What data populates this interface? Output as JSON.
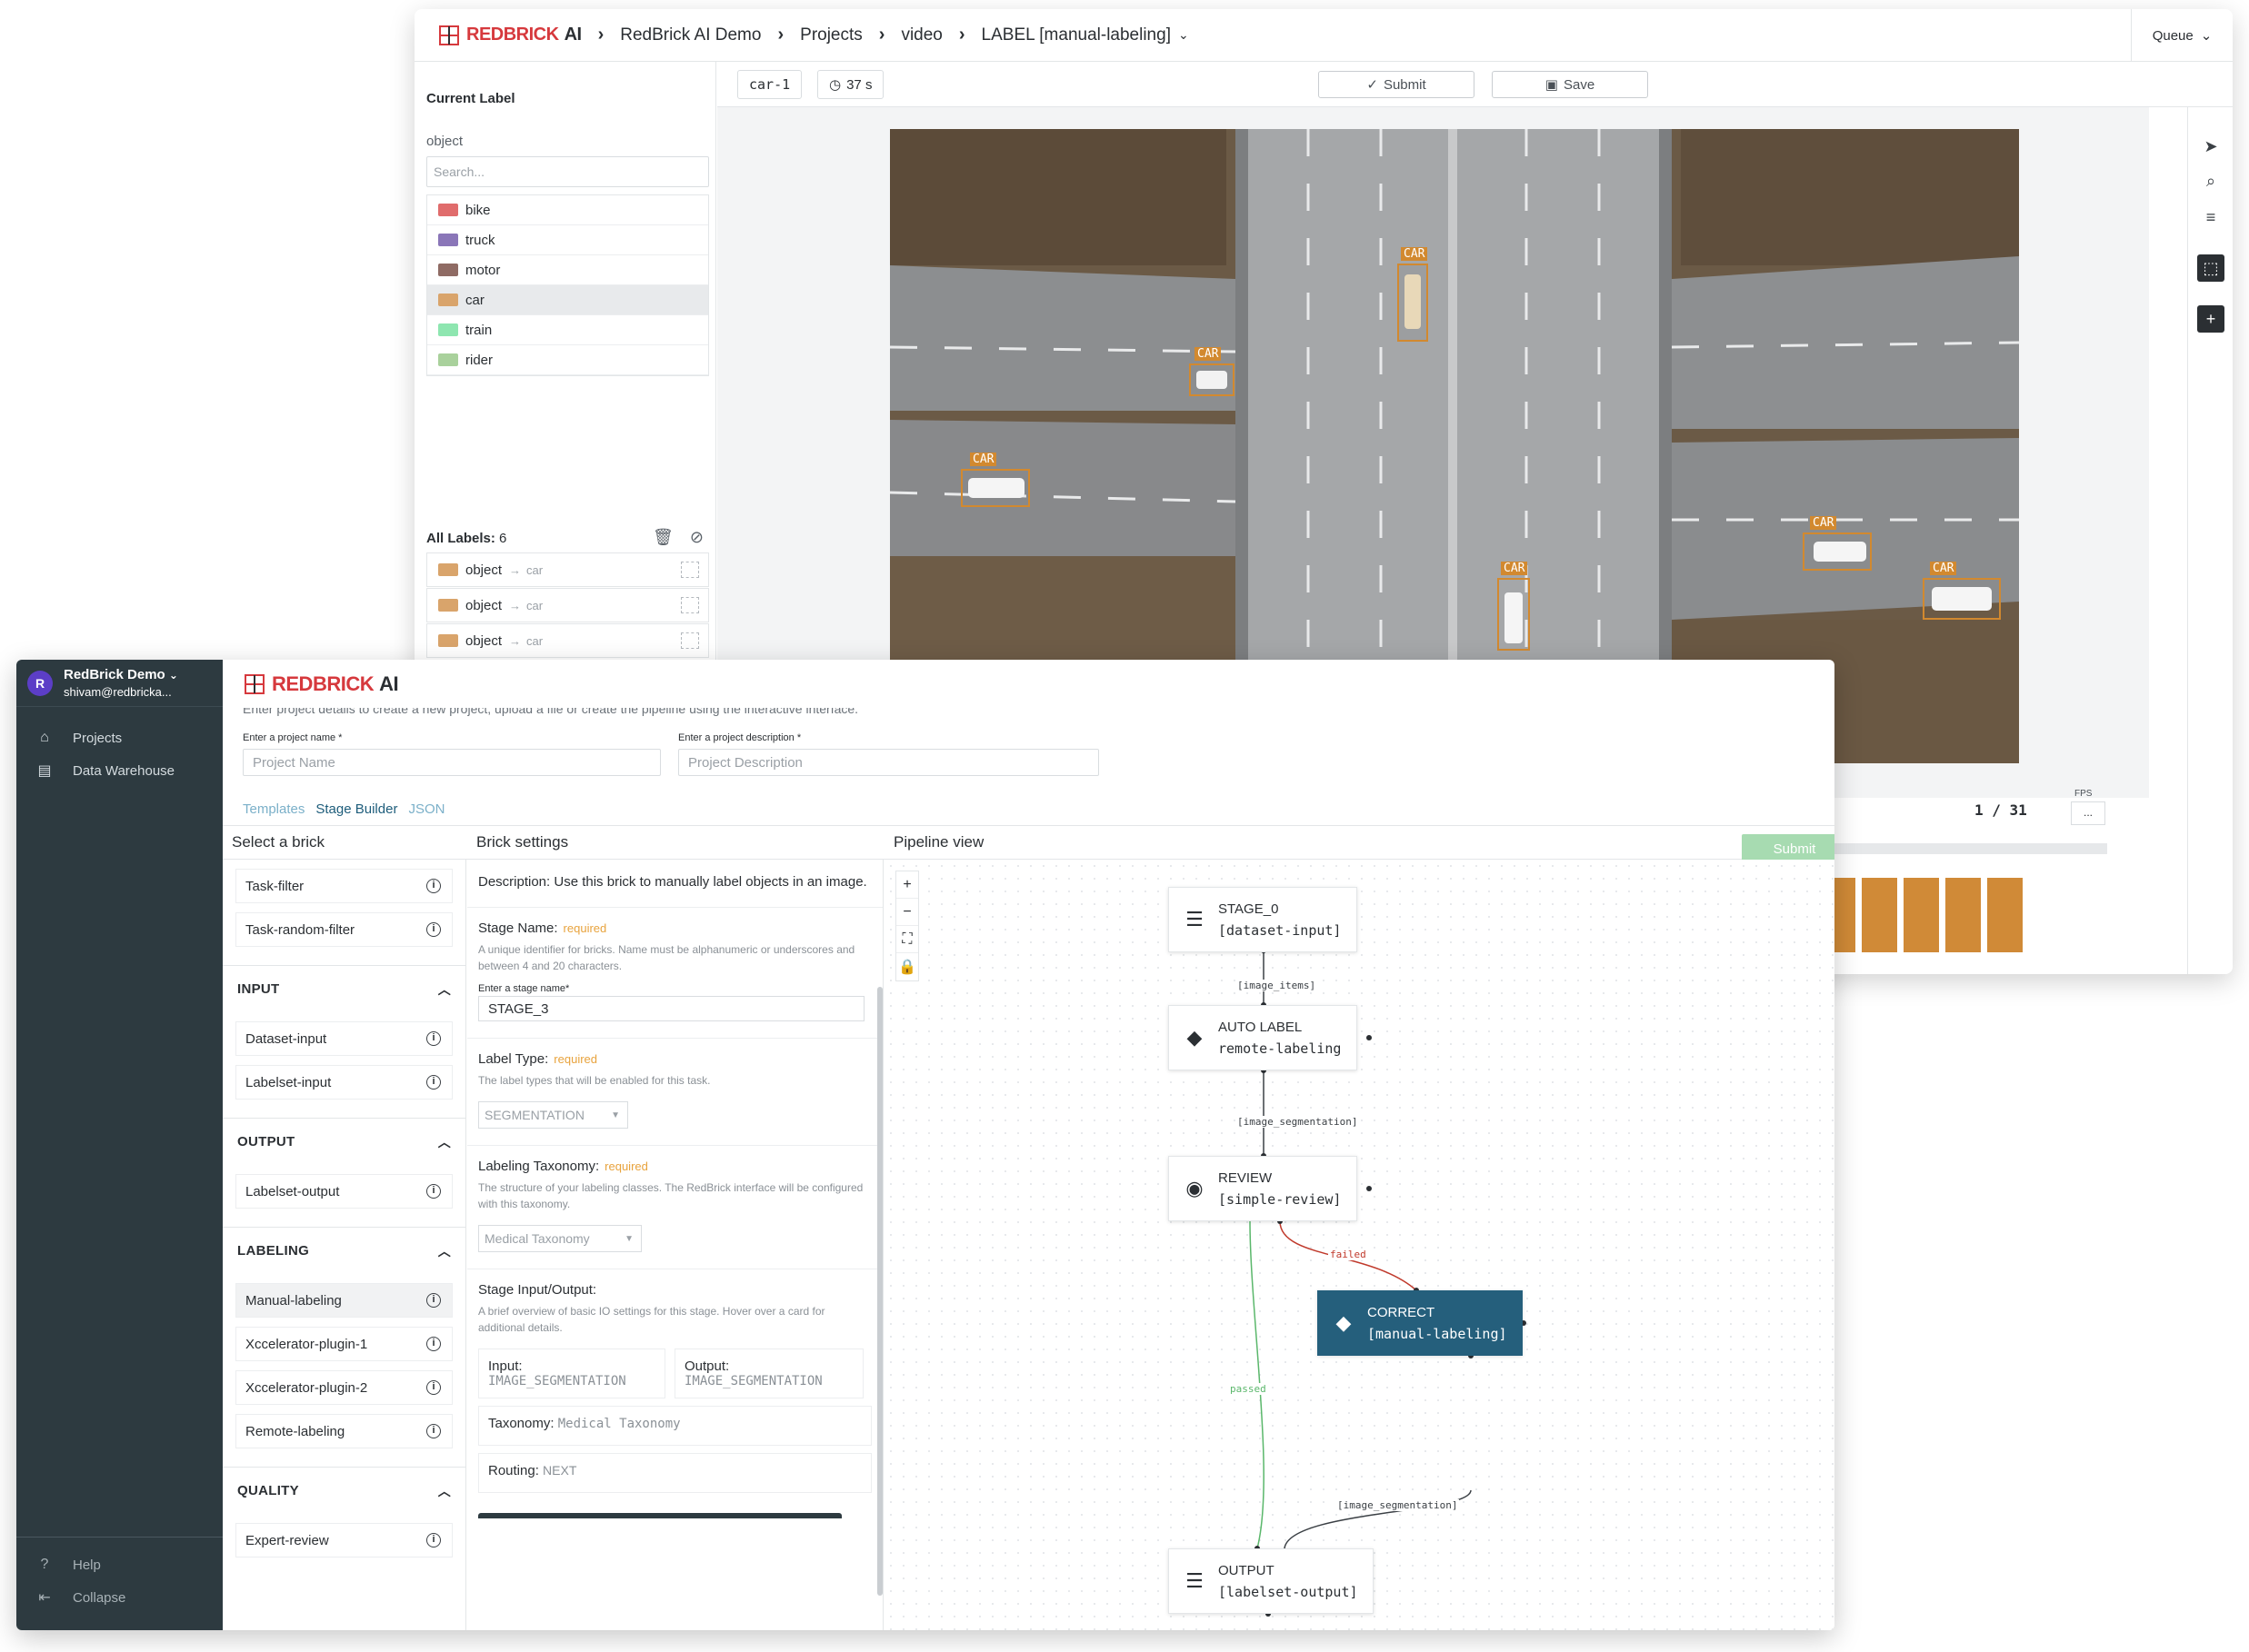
{
  "back": {
    "logo": {
      "red": "REDBRICK",
      "dark": "AI"
    },
    "breadcrumbs": [
      "RedBrick AI Demo",
      "Projects",
      "video",
      "LABEL [manual-labeling]"
    ],
    "current_label_title": "Current Label",
    "object_label": "object",
    "search_placeholder": "Search...",
    "classes": [
      {
        "name": "bike",
        "color": "#e06c6c"
      },
      {
        "name": "truck",
        "color": "#8a76b8"
      },
      {
        "name": "motor",
        "color": "#8f6b64"
      },
      {
        "name": "car",
        "color": "#d9a46b"
      },
      {
        "name": "train",
        "color": "#8ee6b0"
      },
      {
        "name": "rider",
        "color": "#a9d19c"
      }
    ],
    "all_labels_title": "All Labels:",
    "all_labels_count": "6",
    "labels": [
      {
        "cls": "object",
        "sub": "car"
      },
      {
        "cls": "object",
        "sub": "car"
      },
      {
        "cls": "object",
        "sub": "car"
      }
    ],
    "task_chip": "car-1",
    "timer": "37 s",
    "submit_label": "Submit",
    "save_label": "Save",
    "queue_label": "Queue",
    "box_label": "CAR",
    "frame_counter": "1 / 31",
    "fps_label": "FPS",
    "fps_value": "..."
  },
  "front": {
    "org_name": "RedBrick Demo",
    "email": "shivam@redbricka...",
    "avatar_letter": "R",
    "nav": [
      {
        "label": "Projects",
        "icon": "home-icon"
      },
      {
        "label": "Data Warehouse",
        "icon": "database-icon"
      }
    ],
    "bottom_nav": [
      {
        "label": "Help",
        "icon": "help-icon"
      },
      {
        "label": "Collapse",
        "icon": "collapse-icon"
      }
    ],
    "logo": {
      "red": "REDBRICK",
      "dark": "AI"
    },
    "hint": "Enter project details to create a new project, upload a file or create the pipeline using the interactive interface.",
    "project_name_label": "Enter a project name *",
    "project_name_placeholder": "Project Name",
    "project_desc_label": "Enter a project description *",
    "project_desc_placeholder": "Project Description",
    "tabs": [
      "Templates",
      "Stage Builder",
      "JSON"
    ],
    "select_brick_title": "Select a brick",
    "brick_settings_title": "Brick settings",
    "pipeline_title": "Pipeline view",
    "pipeline_submit": "Submit",
    "filters": [
      "Task-filter",
      "Task-random-filter"
    ],
    "sections": [
      {
        "title": "INPUT",
        "items": [
          "Dataset-input",
          "Labelset-input"
        ]
      },
      {
        "title": "OUTPUT",
        "items": [
          "Labelset-output"
        ]
      },
      {
        "title": "LABELING",
        "items": [
          "Manual-labeling",
          "Xccelerator-plugin-1",
          "Xccelerator-plugin-2",
          "Remote-labeling"
        ]
      },
      {
        "title": "QUALITY",
        "items": [
          "Expert-review"
        ]
      }
    ],
    "settings": {
      "description_label": "Description:",
      "description_text": "Use this brick to manually label objects in an image.",
      "stage_name_title": "Stage Name:",
      "required": "required",
      "stage_name_desc": "A unique identifier for bricks. Name must be alphanumeric or underscores and between 4 and 20 characters.",
      "stage_name_field_label": "Enter a stage name*",
      "stage_name_value": "STAGE_3",
      "label_type_title": "Label Type:",
      "label_type_desc": "The label types that will be enabled for this task.",
      "label_type_value": "SEGMENTATION",
      "taxonomy_title": "Labeling Taxonomy:",
      "taxonomy_desc": "The structure of your labeling classes. The RedBrick interface will be configured with this taxonomy.",
      "taxonomy_value": "Medical Taxonomy",
      "io_title": "Stage Input/Output:",
      "io_desc": "A brief overview of basic IO settings for this stage. Hover over a card for additional details.",
      "input_label": "Input:",
      "input_value": "IMAGE_SEGMENTATION",
      "output_label": "Output:",
      "output_value": "IMAGE_SEGMENTATION",
      "tax_label": "Taxonomy:",
      "tax_value": "Medical Taxonomy",
      "routing_label": "Routing:",
      "routing_value": "NEXT"
    },
    "nodes": [
      {
        "title": "STAGE_0",
        "sub": "[dataset-input]",
        "icon": "list-icon"
      },
      {
        "title": "AUTO LABEL",
        "sub": "remote-labeling",
        "icon": "tag-icon"
      },
      {
        "title": "REVIEW",
        "sub": "[simple-review]",
        "icon": "eye-icon"
      },
      {
        "title": "CORRECT",
        "sub": "[manual-labeling]",
        "icon": "tag-icon"
      },
      {
        "title": "OUTPUT",
        "sub": "[labelset-output]",
        "icon": "list-icon"
      }
    ],
    "edges": [
      "[image_items]",
      "[image_segmentation]",
      "failed",
      "passed",
      "[image_segmentation]"
    ]
  }
}
